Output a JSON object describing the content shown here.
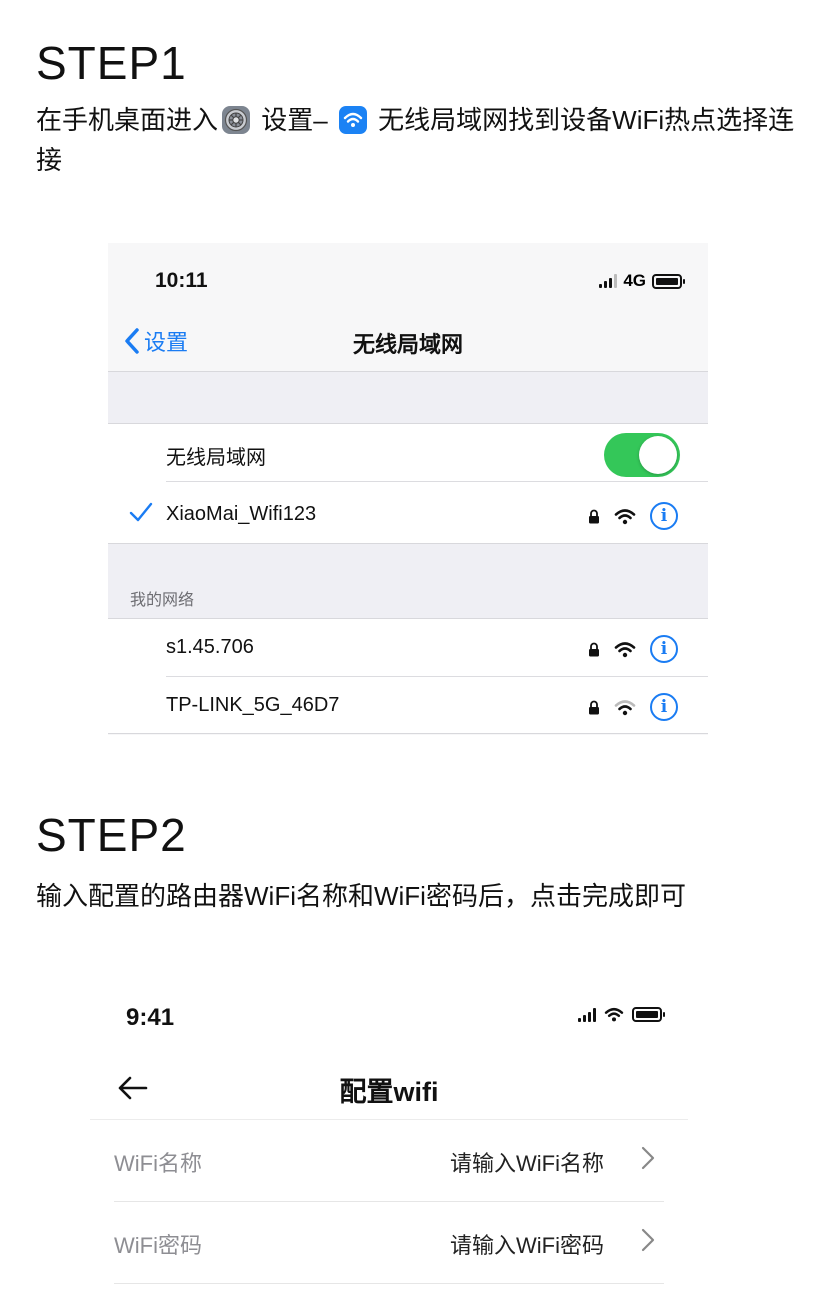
{
  "step1": {
    "title": "STEP1",
    "instr_part1": "在手机桌面进入",
    "instr_part2": " 设置– ",
    "instr_part3": " 无线局域网找到设备WiFi热点选择连接"
  },
  "phone1": {
    "time": "10:11",
    "network": "4G",
    "back_label": "设置",
    "nav_title": "无线局域网",
    "wifi_toggle_label": "无线局域网",
    "wifi_toggle_on": true,
    "connected_network": "XiaoMai_Wifi123",
    "my_networks_label": "我的网络",
    "networks": [
      {
        "name": "s1.45.706"
      },
      {
        "name": "TP-LINK_5G_46D7"
      }
    ]
  },
  "step2": {
    "title": "STEP2",
    "instr": "输入配置的路由器WiFi名称和WiFi密码后，点击完成即可"
  },
  "phone2": {
    "time": "9:41",
    "nav_title": "配置wifi",
    "fields": [
      {
        "label": "WiFi名称",
        "placeholder": "请输入WiFi名称"
      },
      {
        "label": "WiFi密码",
        "placeholder": "请输入WiFi密码"
      }
    ]
  },
  "colors": {
    "accent_blue": "#1a7cf3",
    "toggle_green": "#34c759",
    "group_bg": "#efeff4"
  }
}
